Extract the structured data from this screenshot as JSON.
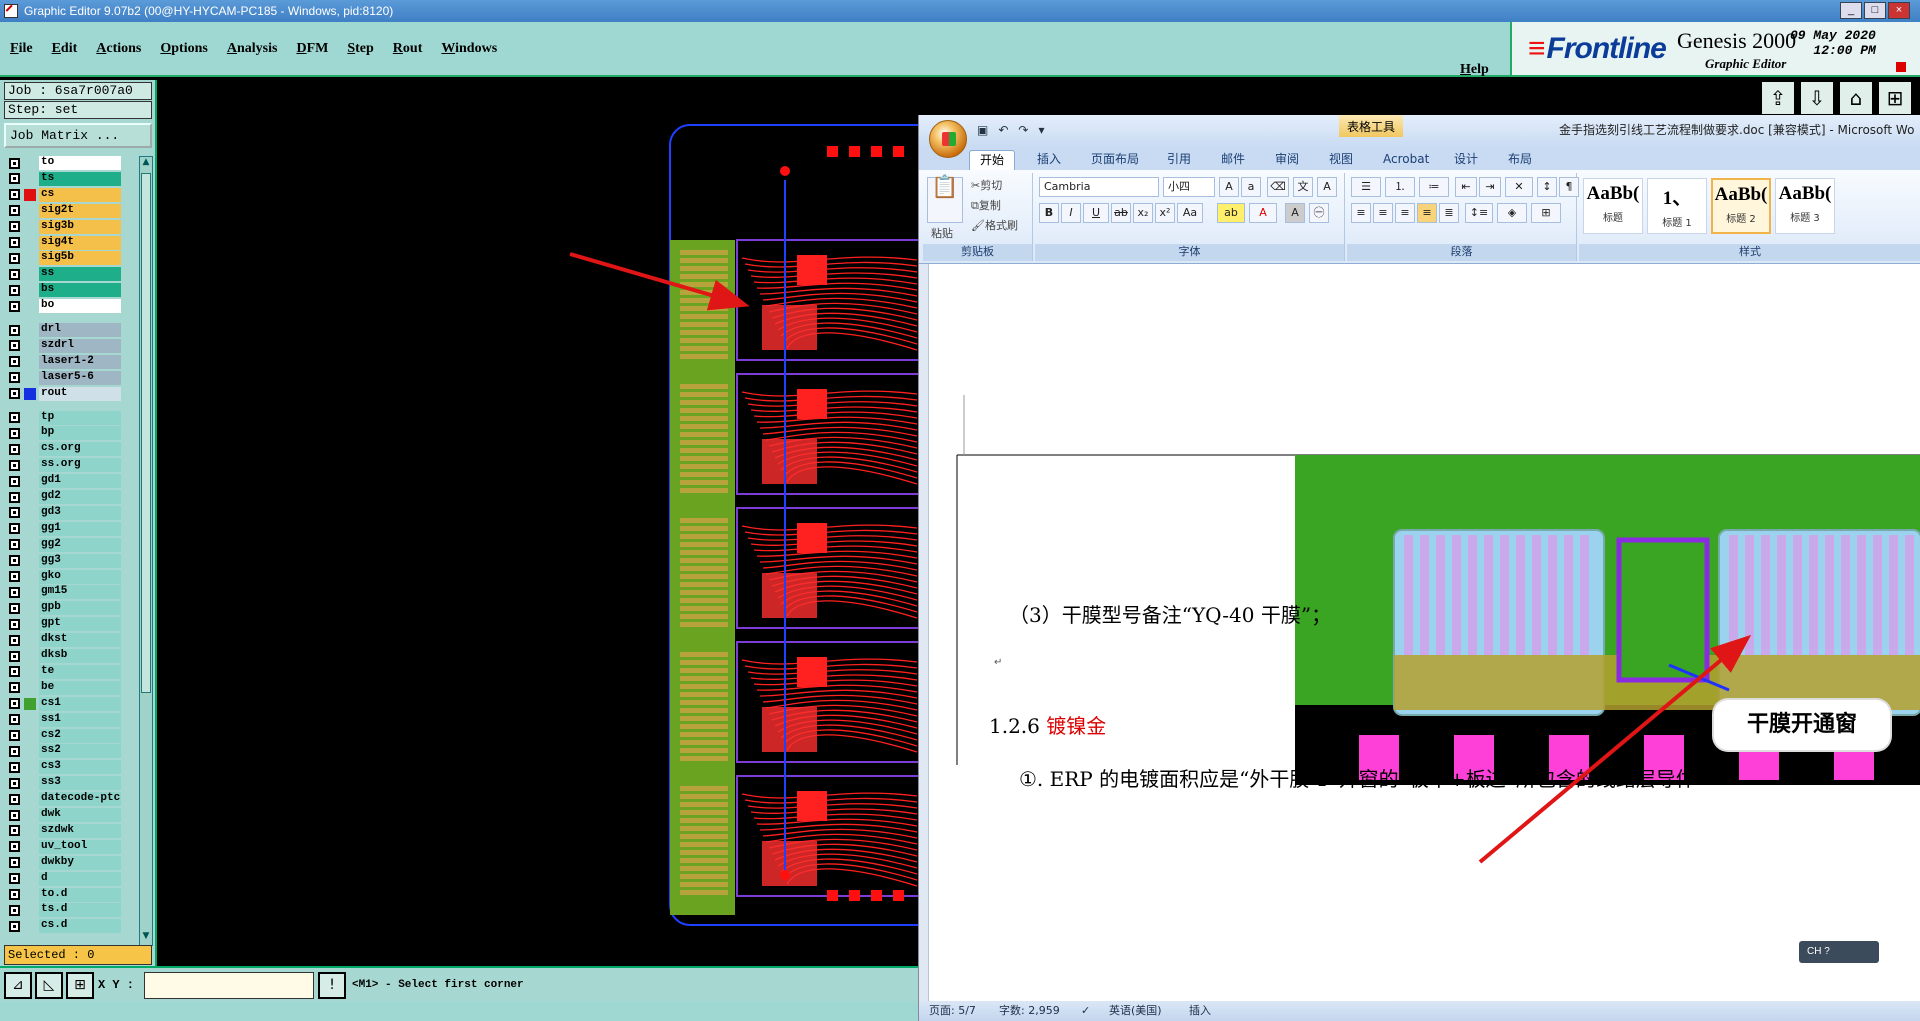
{
  "genesis": {
    "title": "Graphic Editor 9.07b2 (00@HY-HYCAM-PC185 - Windows, pid:8120)",
    "menu": [
      "File",
      "Edit",
      "Actions",
      "Options",
      "Analysis",
      "DFM",
      "Step",
      "Rout",
      "Windows"
    ],
    "help": "Help",
    "brand": {
      "logo": "Frontline",
      "product": "Genesis 2000",
      "subtitle": "Graphic Editor",
      "date_line1": "09 May 2020",
      "date_line2": "12:00 PM"
    },
    "job": "Job : 6sa7r007a0",
    "step": "Step: set",
    "job_matrix": "Job Matrix ...",
    "layers": [
      {
        "name": "to",
        "color": "#ffffff",
        "swatch": ""
      },
      {
        "name": "ts",
        "color": "#1fae8a",
        "swatch": ""
      },
      {
        "name": "cs",
        "color": "#f5c04a",
        "swatch": "#e01010"
      },
      {
        "name": "sig2t",
        "color": "#f5c04a",
        "swatch": ""
      },
      {
        "name": "sig3b",
        "color": "#f5c04a",
        "swatch": ""
      },
      {
        "name": "sig4t",
        "color": "#f5c04a",
        "swatch": ""
      },
      {
        "name": "sig5b",
        "color": "#f5c04a",
        "swatch": ""
      },
      {
        "name": "ss",
        "color": "#1fae8a",
        "swatch": ""
      },
      {
        "name": "bs",
        "color": "#1fae8a",
        "swatch": ""
      },
      {
        "name": "bo",
        "color": "#ffffff",
        "swatch": ""
      },
      {
        "name": "drl",
        "color": "#9fb7c4",
        "swatch": ""
      },
      {
        "name": "szdrl",
        "color": "#9fb7c4",
        "swatch": ""
      },
      {
        "name": "laser1-2",
        "color": "#9fb7c4",
        "swatch": ""
      },
      {
        "name": "laser5-6",
        "color": "#9fb7c4",
        "swatch": ""
      },
      {
        "name": "rout",
        "color": "#cfe0e8",
        "swatch": "#1530e0"
      },
      {
        "name": "tp",
        "color": "#8fd4cb",
        "swatch": ""
      },
      {
        "name": "bp",
        "color": "#8fd4cb",
        "swatch": ""
      },
      {
        "name": "cs.org",
        "color": "#8fd4cb",
        "swatch": ""
      },
      {
        "name": "ss.org",
        "color": "#8fd4cb",
        "swatch": ""
      },
      {
        "name": "gd1",
        "color": "#8fd4cb",
        "swatch": ""
      },
      {
        "name": "gd2",
        "color": "#8fd4cb",
        "swatch": ""
      },
      {
        "name": "gd3",
        "color": "#8fd4cb",
        "swatch": ""
      },
      {
        "name": "gg1",
        "color": "#8fd4cb",
        "swatch": ""
      },
      {
        "name": "gg2",
        "color": "#8fd4cb",
        "swatch": ""
      },
      {
        "name": "gg3",
        "color": "#8fd4cb",
        "swatch": ""
      },
      {
        "name": "gko",
        "color": "#8fd4cb",
        "swatch": ""
      },
      {
        "name": "gm15",
        "color": "#8fd4cb",
        "swatch": ""
      },
      {
        "name": "gpb",
        "color": "#8fd4cb",
        "swatch": ""
      },
      {
        "name": "gpt",
        "color": "#8fd4cb",
        "swatch": ""
      },
      {
        "name": "dkst",
        "color": "#8fd4cb",
        "swatch": ""
      },
      {
        "name": "dksb",
        "color": "#8fd4cb",
        "swatch": ""
      },
      {
        "name": "te",
        "color": "#8fd4cb",
        "swatch": ""
      },
      {
        "name": "be",
        "color": "#8fd4cb",
        "swatch": ""
      },
      {
        "name": "cs1",
        "color": "#8fd4cb",
        "swatch": "#40a030"
      },
      {
        "name": "ss1",
        "color": "#8fd4cb",
        "swatch": ""
      },
      {
        "name": "cs2",
        "color": "#8fd4cb",
        "swatch": ""
      },
      {
        "name": "ss2",
        "color": "#8fd4cb",
        "swatch": ""
      },
      {
        "name": "cs3",
        "color": "#8fd4cb",
        "swatch": ""
      },
      {
        "name": "ss3",
        "color": "#8fd4cb",
        "swatch": ""
      },
      {
        "name": "datecode-ptc",
        "color": "#8fd4cb",
        "swatch": ""
      },
      {
        "name": "dwk",
        "color": "#8fd4cb",
        "swatch": ""
      },
      {
        "name": "szdwk",
        "color": "#8fd4cb",
        "swatch": ""
      },
      {
        "name": "uv_tool",
        "color": "#8fd4cb",
        "swatch": ""
      },
      {
        "name": "dwkby",
        "color": "#8fd4cb",
        "swatch": ""
      },
      {
        "name": "d",
        "color": "#8fd4cb",
        "swatch": ""
      },
      {
        "name": "to.d",
        "color": "#8fd4cb",
        "swatch": ""
      },
      {
        "name": "ts.d",
        "color": "#8fd4cb",
        "swatch": ""
      },
      {
        "name": "cs.d",
        "color": "#8fd4cb",
        "swatch": ""
      }
    ],
    "selected": "Selected : 0",
    "xy_label": "X Y :",
    "xy_value": "",
    "prompt": "<M1> - Select first corner"
  },
  "word": {
    "title": "金手指选刻引线工艺流程制做要求.doc [兼容模式] - Microsoft Wo",
    "table_tools": "表格工具",
    "tabs": [
      "开始",
      "插入",
      "页面布局",
      "引用",
      "邮件",
      "审阅",
      "视图",
      "Acrobat",
      "设计",
      "布局"
    ],
    "clipboard": {
      "paste": "粘贴",
      "cut": "剪切",
      "copy": "复制",
      "format_painter": "格式刷",
      "label": "剪贴板"
    },
    "font": {
      "name": "Cambria",
      "size": "小四",
      "label": "字体"
    },
    "paragraph_label": "段落",
    "styles": [
      {
        "preview": "AaBb(",
        "name": "标题"
      },
      {
        "preview": "1、",
        "name": "标题 1"
      },
      {
        "preview": "AaBb(",
        "name": "标题 2"
      },
      {
        "preview": "AaBb(",
        "name": "标题 3"
      }
    ],
    "styles_label": "样式",
    "callout": "干膜开通窗",
    "p_three": "（3）干膜型号备注“YQ-40 干膜”；",
    "p_head_num": "1.2.6",
    "p_head_text": "镀镍金",
    "p_one": "①. ERP 的电镀面积应是“外干膜 1”开窗的“板中+板边”所包含的线路层导体",
    "status": {
      "page": "页面: 5/7",
      "words": "字数: 2,959",
      "lang": "英语(美国)",
      "mode": "插入"
    },
    "ime": "CH"
  }
}
